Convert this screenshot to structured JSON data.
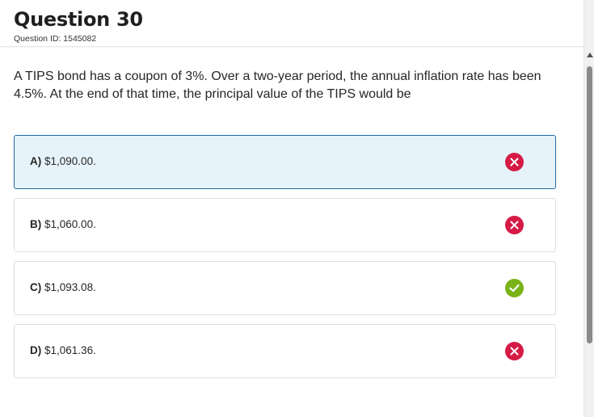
{
  "question": {
    "title": "Question 30",
    "id_text": "Question ID: 1545082",
    "stem": "A TIPS bond has a coupon of 3%. Over a two-year period, the annual inflation rate has been 4.5%. At the end of that time, the principal value of the TIPS would be"
  },
  "options": [
    {
      "letter": "A)",
      "text": "$1,090.00.",
      "selected": true,
      "status": "incorrect",
      "status_icon": "x-circle-icon"
    },
    {
      "letter": "B)",
      "text": "$1,060.00.",
      "selected": false,
      "status": "incorrect",
      "status_icon": "x-circle-icon"
    },
    {
      "letter": "C)",
      "text": "$1,093.08.",
      "selected": false,
      "status": "correct",
      "status_icon": "check-circle-icon"
    },
    {
      "letter": "D)",
      "text": "$1,061.36.",
      "selected": false,
      "status": "incorrect",
      "status_icon": "x-circle-icon"
    }
  ],
  "colors": {
    "selected_bg": "#e6f3fa",
    "selected_border": "#1f6aa5",
    "incorrect": "#d61a46",
    "correct": "#7ab317"
  }
}
